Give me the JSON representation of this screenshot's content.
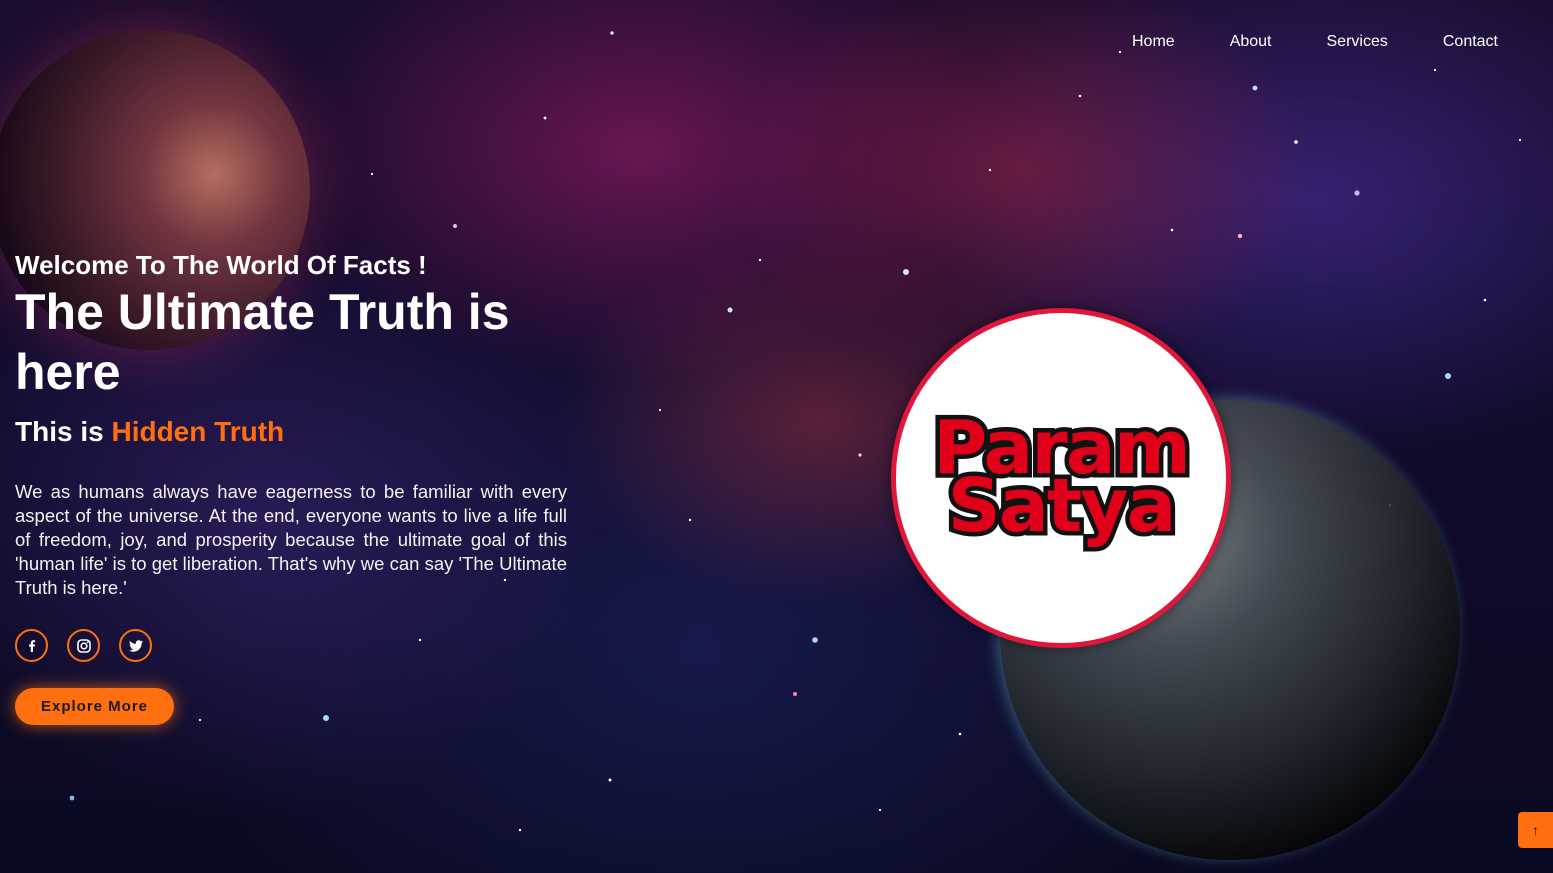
{
  "nav": {
    "items": [
      {
        "label": "Home"
      },
      {
        "label": "About"
      },
      {
        "label": "Services"
      },
      {
        "label": "Contact"
      }
    ]
  },
  "hero": {
    "welcome": "Welcome To The World Of Facts !",
    "title": "The Ultimate Truth is here",
    "subtitle_prefix": "This is ",
    "subtitle_highlight": "Hidden Truth",
    "description": "We as humans always have eagerness to be familiar with every aspect of the universe. At the end, everyone wants to live a life full of freedom, joy, and prosperity because the ultimate goal of this 'human life' is to get liberation. That's why we can say 'The Ultimate Truth is here.'",
    "cta_label": "Explore More"
  },
  "socials": [
    {
      "icon": "facebook-icon"
    },
    {
      "icon": "instagram-icon"
    },
    {
      "icon": "twitter-icon"
    }
  ],
  "logo": {
    "line1": "Param",
    "line2": "Satya"
  },
  "scroll_top": {
    "icon": "arrow-up-icon",
    "glyph": "↑"
  },
  "colors": {
    "accent": "#ff6f0f",
    "logo_ring": "#e0173a",
    "logo_text": "#e0001a"
  }
}
